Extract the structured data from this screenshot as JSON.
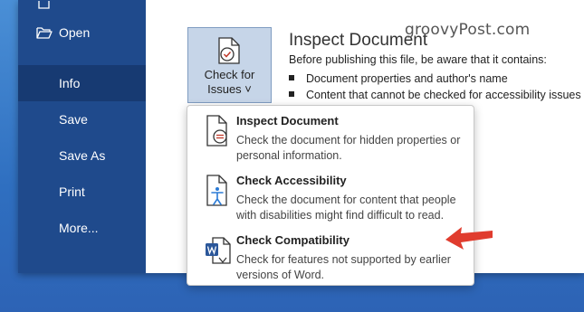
{
  "sidebar": {
    "items": [
      {
        "label": "Open",
        "icon": "folder-open-icon"
      },
      {
        "label": "Info",
        "active": true
      },
      {
        "label": "Save"
      },
      {
        "label": "Save As"
      },
      {
        "label": "Print"
      },
      {
        "label": "More..."
      }
    ]
  },
  "check_button": {
    "line1": "Check for",
    "line2": "Issues ˅",
    "icon": "document-check-icon"
  },
  "inspect_section": {
    "title": "Inspect Document",
    "description": "Before publishing this file, be aware that it contains:",
    "bullets": [
      "Document properties and author's name",
      "Content that cannot be checked for accessibility issues b"
    ]
  },
  "watermark": "groovyPost.com",
  "dropdown": {
    "items": [
      {
        "title": "Inspect Document",
        "description": "Check the document for hidden properties or personal information.",
        "icon": "inspect-document-icon"
      },
      {
        "title": "Check Accessibility",
        "description": "Check the document for content that people with disabilities might find difficult to read.",
        "icon": "accessibility-icon"
      },
      {
        "title": "Check Compatibility",
        "description": "Check for features not supported by earlier versions of Word.",
        "icon": "word-compatibility-icon"
      }
    ]
  },
  "colors": {
    "sidebar": "#1f4a8c",
    "sidebar_active": "#173a72",
    "button_bg": "#c6d5e8",
    "arrow": "#e03c2e",
    "desktop": "#3a7fcf"
  }
}
